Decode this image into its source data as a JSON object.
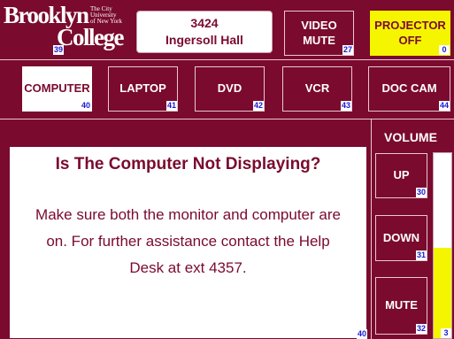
{
  "logo": {
    "line1": "Brooklyn",
    "line2": "College",
    "tagline": [
      "The City",
      "University",
      "of New York"
    ],
    "number": "39"
  },
  "room": {
    "number": "3424",
    "name": "Ingersoll Hall"
  },
  "video_mute": {
    "label_line1": "VIDEO",
    "label_line2": "MUTE",
    "number": "27"
  },
  "projector": {
    "label_line1": "PROJECTOR",
    "label_line2": "OFF",
    "number": "0",
    "color": "#f5f500"
  },
  "sources": [
    {
      "label": "COMPUTER",
      "number": "40",
      "active": true
    },
    {
      "label": "LAPTOP",
      "number": "41",
      "active": false
    },
    {
      "label": "DVD",
      "number": "42",
      "active": false
    },
    {
      "label": "VCR",
      "number": "43",
      "active": false
    },
    {
      "label": "DOC CAM",
      "number": "44",
      "active": false
    }
  ],
  "message": {
    "title": "Is The Computer Not Displaying?",
    "body": "Make sure both the monitor and computer are on. For further assistance contact the Help Desk at ext 4357.",
    "number": "40"
  },
  "volume": {
    "label": "VOLUME",
    "up": {
      "label": "UP",
      "number": "30"
    },
    "down": {
      "label": "DOWN",
      "number": "31"
    },
    "mute": {
      "label": "MUTE",
      "number": "32"
    },
    "level_fraction": 0.49,
    "meter_number": "3"
  },
  "colors": {
    "background": "#7a0a2e",
    "accent": "#f5f500",
    "badge_text": "#1a1ad0"
  }
}
